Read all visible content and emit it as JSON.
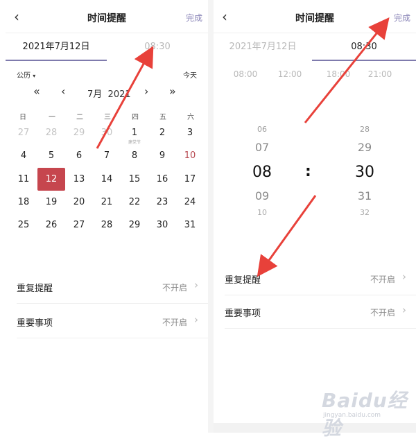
{
  "left": {
    "header": {
      "back_icon": "chevron-left-icon",
      "title": "时间提醒",
      "done": "完成"
    },
    "tabs": {
      "date": "2021年7月12日",
      "time": "08:30",
      "active": "date"
    },
    "calendar": {
      "mode": "公历",
      "today": "今天",
      "prev_year": "«",
      "prev_month": "‹",
      "month": "7月",
      "year": "2021",
      "next_month": "›",
      "next_year": "»",
      "weekdays": [
        "日",
        "一",
        "二",
        "三",
        "四",
        "五",
        "六"
      ],
      "weeks": [
        [
          "27",
          "28",
          "29",
          "30",
          "1",
          "2",
          "3"
        ],
        [
          "4",
          "5",
          "6",
          "7",
          "8",
          "9",
          "10"
        ],
        [
          "11",
          "12",
          "13",
          "14",
          "15",
          "16",
          "17"
        ],
        [
          "18",
          "19",
          "20",
          "21",
          "22",
          "23",
          "24"
        ],
        [
          "25",
          "26",
          "27",
          "28",
          "29",
          "30",
          "31"
        ]
      ],
      "festival_label": "建党节",
      "selected": "12",
      "selected_color": "#c6464e",
      "holiday_color": "#b84a52"
    },
    "rows": [
      {
        "label": "重复提醒",
        "value": "不开启"
      },
      {
        "label": "重要事项",
        "value": "不开启"
      }
    ]
  },
  "right": {
    "header": {
      "back_icon": "chevron-left-icon",
      "title": "时间提醒",
      "done": "完成"
    },
    "tabs": {
      "date": "2021年7月12日",
      "time": "08:30",
      "active": "time"
    },
    "presets": [
      "08:00",
      "12:00",
      "18:00",
      "21:00"
    ],
    "hours": [
      "06",
      "07",
      "08",
      "09",
      "10"
    ],
    "minutes": [
      "28",
      "29",
      "30",
      "31",
      "32"
    ],
    "separator": ":",
    "rows": [
      {
        "label": "重复提醒",
        "value": "不开启"
      },
      {
        "label": "重要事项",
        "value": "不开启"
      }
    ]
  },
  "watermark": {
    "brand": "Baidu经验",
    "url": "jingyan.baidu.com"
  },
  "accent_color": "#7f7bad",
  "annotation_arrow_color": "#e8413a"
}
